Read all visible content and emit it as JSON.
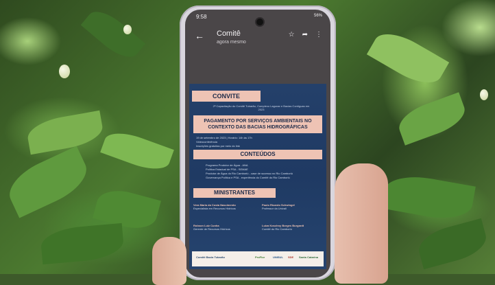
{
  "phone": {
    "status": {
      "time": "9:58",
      "right": "56%"
    },
    "appbar": {
      "back_icon": "arrow-left-icon",
      "title": "Comitê",
      "subtitle": "agora mesmo",
      "icons": [
        "star-icon",
        "share-icon",
        "more-vertical-icon"
      ]
    }
  },
  "flyer": {
    "convite": "CONVITE",
    "subtitle": "2ª Capacitação do Comitê Tubarão, Complexo Lagunar e Bacias Contíguas em 2023",
    "headline": "PAGAMENTO POR SERVIÇOS AMBIENTAIS NO CONTEXTO DAS BACIAS HIDROGRÁFICAS",
    "details": [
      "19 de setembro de 2023 | Horário: 14h às 17h",
      "Videoconferência",
      "Inscrições gratuitas por meio do link"
    ],
    "conteudos": "CONTEÚDOS",
    "topics": [
      "Programa Produtor de Água - ANA",
      "Política Estadual de PSA - SEMAE",
      "Produtor de Água do Rio Camboriú - case de sucesso no Rio Camboriú",
      "Governança Política e PSA - experiência do Comitê do Rio Camboriú"
    ],
    "ministrantes": "MINISTRANTES",
    "people": [
      {
        "name": "Vera Maria da Costa Nascimento",
        "role": "Especialista em Recursos Hídricos"
      },
      {
        "name": "Paulo Ricardo Schwingel",
        "role": "Professor da Univali"
      },
      {
        "name": "Robson Luiz Cunha",
        "role": "Gerente de Recursos Hídricos"
      },
      {
        "name": "Luiza Koschny Borges Burgardt",
        "role": "Comitê do Rio Camboriú"
      }
    ],
    "footer_logos": [
      "Comitê Bacia Tubarão",
      "ProFlor",
      "UNISUL",
      "SDE",
      "Santa Catarina"
    ]
  }
}
